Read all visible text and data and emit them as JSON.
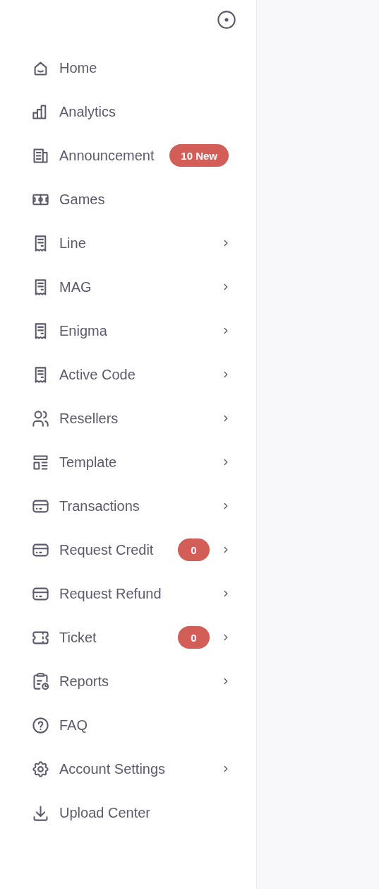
{
  "menu": [
    {
      "label": "Home",
      "expandable": false
    },
    {
      "label": "Analytics",
      "expandable": false
    },
    {
      "label": "Announcement",
      "badge": "10 New",
      "expandable": false
    },
    {
      "label": "Games",
      "expandable": false
    },
    {
      "label": "Line",
      "expandable": true
    },
    {
      "label": "MAG",
      "expandable": true
    },
    {
      "label": "Enigma",
      "expandable": true
    },
    {
      "label": "Active Code",
      "expandable": true
    },
    {
      "label": "Resellers",
      "expandable": true
    },
    {
      "label": "Template",
      "expandable": true
    },
    {
      "label": "Transactions",
      "expandable": true
    },
    {
      "label": "Request Credit",
      "badge": "0",
      "expandable": true
    },
    {
      "label": "Request Refund",
      "expandable": true
    },
    {
      "label": "Ticket",
      "badge": "0",
      "expandable": true
    },
    {
      "label": "Reports",
      "expandable": true
    },
    {
      "label": "FAQ",
      "expandable": false
    },
    {
      "label": "Account Settings",
      "expandable": true
    },
    {
      "label": "Upload Center",
      "expandable": false
    }
  ]
}
